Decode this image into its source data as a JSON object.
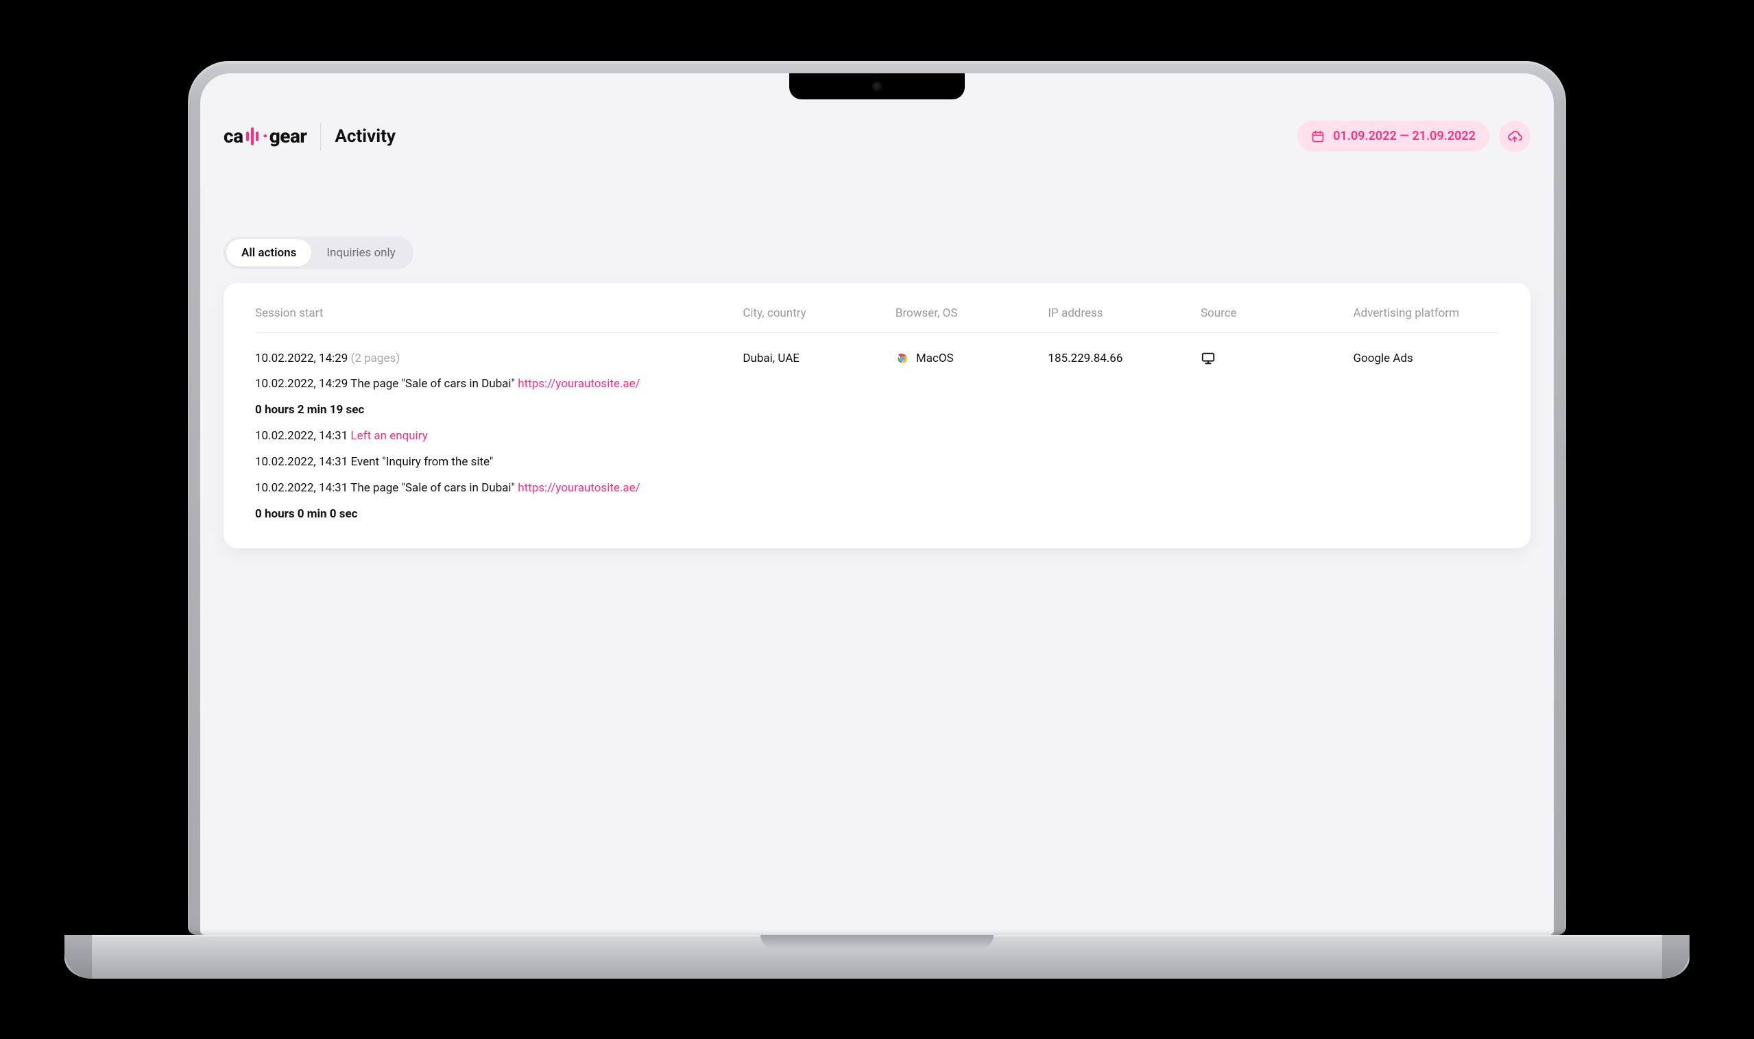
{
  "brand": {
    "part1": "ca",
    "part2": "gear"
  },
  "page_title": "Activity",
  "date_range": "01.09.2022 — 21.09.2022",
  "tabs": {
    "all_actions": "All actions",
    "inquiries_only": "Inquiries only"
  },
  "columns": {
    "session_start": "Session start",
    "city_country": "City, country",
    "browser_os": "Browser, OS",
    "ip_address": "IP address",
    "source": "Source",
    "ad_platform": "Advertising platform"
  },
  "row": {
    "session_time": "10.02.2022, 14:29",
    "pages_note": "(2 pages)",
    "city": "Dubai, UAE",
    "os": "MacOS",
    "browser_icon": "chrome-icon",
    "ip": "185.229.84.66",
    "source_icon": "desktop-icon",
    "ad_platform": "Google Ads"
  },
  "activity": {
    "l1_time": "10.02.2022, 14:29",
    "l1_text": " The page \"Sale of cars in Dubai\" ",
    "l1_link": "https://yourautosite.ae/",
    "l2_duration": "0 hours 2 min 19 sec",
    "l3_time": "10.02.2022, 14:31",
    "l3_action": " Left an enquiry",
    "l4_time": "10.02.2022, 14:31",
    "l4_text": " Event \"Inquiry from the site\"",
    "l5_time": "10.02.2022, 14:31",
    "l5_text": " The page \"Sale of cars in Dubai\" ",
    "l5_link": "https://yourautosite.ae/",
    "l6_duration": "0 hours 0 min 0 sec"
  }
}
